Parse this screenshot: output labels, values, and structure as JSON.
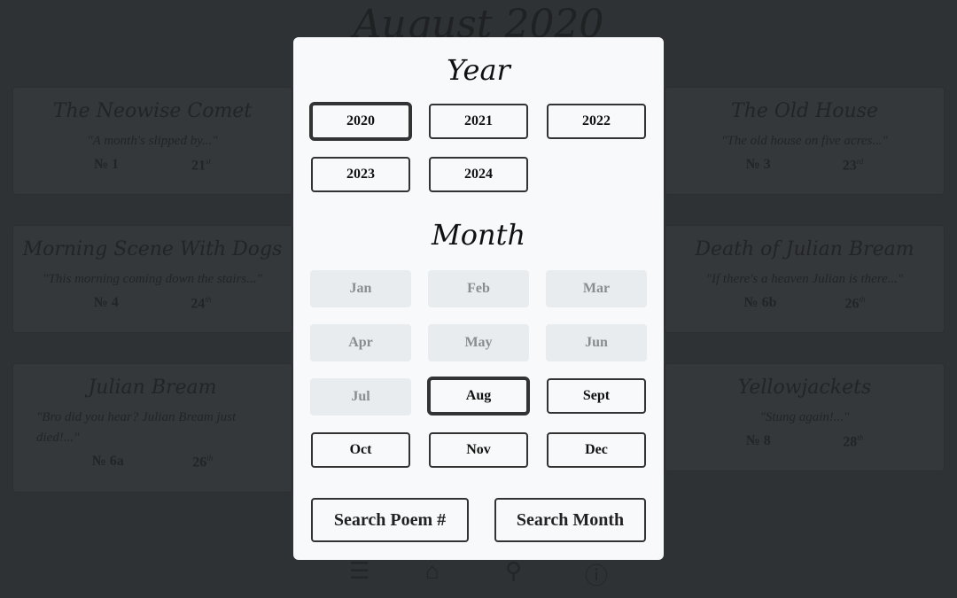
{
  "page_title": "August 2020",
  "cards": [
    {
      "title": "The Neowise Comet",
      "quote": "\"A month's slipped by...\"",
      "number": "№ 1",
      "day": "21",
      "suffix": "st"
    },
    {
      "title": "The Old House",
      "quote": "\"The old house on five acres...\"",
      "number": "№ 3",
      "day": "23",
      "suffix": "rd"
    },
    {
      "title": "Morning Scene With Dogs",
      "quote": "\"This morning coming down the stairs...\"",
      "number": "№ 4",
      "day": "24",
      "suffix": "th"
    },
    {
      "title": "Death of Julian Bream",
      "quote": "\"If there's a heaven Julian is there...\"",
      "number": "№ 6b",
      "day": "26",
      "suffix": "th"
    },
    {
      "title": "Julian Bream",
      "quote": "\"Bro did you hear? Julian Bream just died!...\"",
      "number": "№ 6a",
      "day": "26",
      "suffix": "th"
    },
    {
      "title": "Yellowjackets",
      "quote": "\"Stung again!...\"",
      "number": "№ 8",
      "day": "28",
      "suffix": "th"
    }
  ],
  "modal": {
    "year_heading": "Year",
    "years": [
      "2020",
      "2021",
      "2022",
      "2023",
      "2024"
    ],
    "selected_year": "2020",
    "month_heading": "Month",
    "months": [
      "Jan",
      "Feb",
      "Mar",
      "Apr",
      "May",
      "Jun",
      "Jul",
      "Aug",
      "Sept",
      "Oct",
      "Nov",
      "Dec"
    ],
    "disabled_months": [
      "Jan",
      "Feb",
      "Mar",
      "Apr",
      "May",
      "Jun",
      "Jul"
    ],
    "selected_month": "Aug",
    "search_poem_label": "Search Poem #",
    "search_month_label": "Search Month"
  },
  "nav": [
    "menu-icon",
    "home-icon",
    "search-icon",
    "info-icon"
  ]
}
